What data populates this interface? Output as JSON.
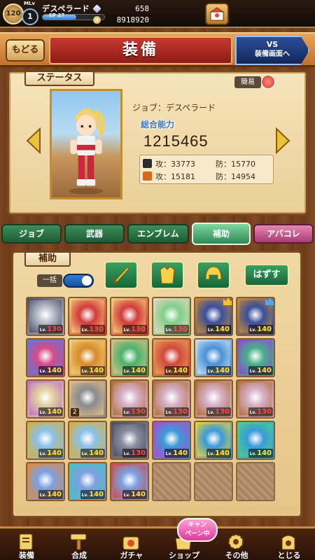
{
  "player": {
    "level": "120",
    "mlv_label": "MLv",
    "mlv": "1",
    "name": "デスペラード",
    "exp_label": "EP 27",
    "exp_fraction": 0.55,
    "gems": "658",
    "gold": "8918920"
  },
  "header": {
    "back_label": "もどる",
    "title": "装備",
    "vs_line1": "VS",
    "vs_line2": "装備画面へ"
  },
  "status": {
    "ribbon": "ステータス",
    "simple_label": "簡易",
    "job_line": "ジョブ：デスペラード",
    "power_label": "総合能力",
    "power_value": "1215465",
    "rows": [
      {
        "atk": "攻：33773",
        "def": "防：15770",
        "icon": "sword-icon"
      },
      {
        "atk": "攻：15181",
        "def": "防：14954",
        "icon": "staff-icon"
      }
    ]
  },
  "tabs": [
    "ジョブ",
    "武器",
    "エンブレム",
    "補助",
    "アバコレ"
  ],
  "active_tab": 3,
  "sub": {
    "ribbon": "補助",
    "bulk_label": "一括",
    "bulk_on": true,
    "remove_label": "はずす",
    "slot_icons": [
      "sword-slot-icon",
      "armor-slot-icon",
      "helmet-slot-icon"
    ]
  },
  "grid": [
    [
      {
        "lv": "130",
        "c": "red",
        "a": "#b7bcc8",
        "b": "#4a4f68"
      },
      {
        "lv": "130",
        "c": "red",
        "a": "#d23a3a",
        "b": "#f0d07a"
      },
      {
        "lv": "130",
        "c": "red",
        "a": "#d23a3a",
        "b": "#f0d07a"
      },
      {
        "lv": "130",
        "c": "red",
        "a": "#7fcf8a",
        "b": "#e4d6c0"
      },
      {
        "lv": "140",
        "c": "yel",
        "a": "#3b4e9a",
        "b": "#c28a3a",
        "crown": "#f6c22a"
      },
      {
        "lv": "140",
        "c": "yel",
        "a": "#3b4e9a",
        "b": "#c28a3a",
        "crown": "#4aa8f6"
      }
    ],
    [
      {
        "lv": "140",
        "c": "yel",
        "a": "#d64a8a",
        "b": "#5a7ad8"
      },
      {
        "lv": "140",
        "c": "yel",
        "a": "#d88a2a",
        "b": "#f0d07a"
      },
      {
        "lv": "140",
        "c": "yel",
        "a": "#4bb26a",
        "b": "#d6c08a"
      },
      {
        "lv": "140",
        "c": "yel",
        "a": "#d04a3a",
        "b": "#e8a05a"
      },
      {
        "lv": "140",
        "c": "yel",
        "a": "#4a90d8",
        "b": "#c8e0f0"
      },
      {
        "lv": "140",
        "c": "yel",
        "a": "#4ab08a",
        "b": "#8a4ad0"
      }
    ],
    [
      {
        "lv": "140",
        "c": "yel",
        "a": "#e0d0a0",
        "b": "#c070c8"
      },
      {
        "lv": "",
        "c": "yel",
        "a": "#8a8a90",
        "b": "#e0c080",
        "count": "2"
      },
      {
        "lv": "130",
        "c": "red",
        "a": "#d6b0c8",
        "b": "#b0703a"
      },
      {
        "lv": "130",
        "c": "red",
        "a": "#d6b0c8",
        "b": "#b0703a"
      },
      {
        "lv": "130",
        "c": "red",
        "a": "#d6b0c8",
        "b": "#b0703a"
      },
      {
        "lv": "130",
        "c": "red",
        "a": "#d6b0c8",
        "b": "#b0703a"
      }
    ],
    [
      {
        "lv": "140",
        "c": "yel",
        "a": "#8ac0e8",
        "b": "#d6b03a"
      },
      {
        "lv": "140",
        "c": "yel",
        "a": "#8ac0e8",
        "b": "#d6b03a"
      },
      {
        "lv": "130",
        "c": "red",
        "a": "#8a8ea0",
        "b": "#4a5060"
      },
      {
        "lv": "140",
        "c": "yel",
        "a": "#3a9ad8",
        "b": "#b04ad0"
      },
      {
        "lv": "140",
        "c": "yel",
        "a": "#3a9ad8",
        "b": "#e8d03a"
      },
      {
        "lv": "140",
        "c": "yel",
        "a": "#3a9ad8",
        "b": "#4ad08a"
      }
    ],
    [
      {
        "lv": "140",
        "c": "yel",
        "a": "#7aa0e0",
        "b": "#e08a3a"
      },
      {
        "lv": "140",
        "c": "yel",
        "a": "#7aa0e0",
        "b": "#4ac0c0"
      },
      {
        "lv": "140",
        "c": "yel",
        "a": "#7aa0e0",
        "b": "#d04a4a"
      },
      {
        "empty": true
      },
      {
        "empty": true
      },
      {
        "empty": true
      }
    ]
  ],
  "nav": [
    {
      "label": "装備",
      "icon": "equip-icon"
    },
    {
      "label": "合成",
      "icon": "hammer-icon"
    },
    {
      "label": "ガチャ",
      "icon": "gacha-icon"
    },
    {
      "label": "ショップ",
      "icon": "shop-icon"
    },
    {
      "label": "その他",
      "icon": "gear-icon"
    },
    {
      "label": "とじる",
      "icon": "close-bag-icon"
    }
  ],
  "campaign": {
    "line1": "キャン",
    "line2": "ペーン中"
  },
  "colors": {
    "accent_red": "#c5392e",
    "tab_green": "#2e8a55",
    "parchment": "#f7e4bb"
  }
}
